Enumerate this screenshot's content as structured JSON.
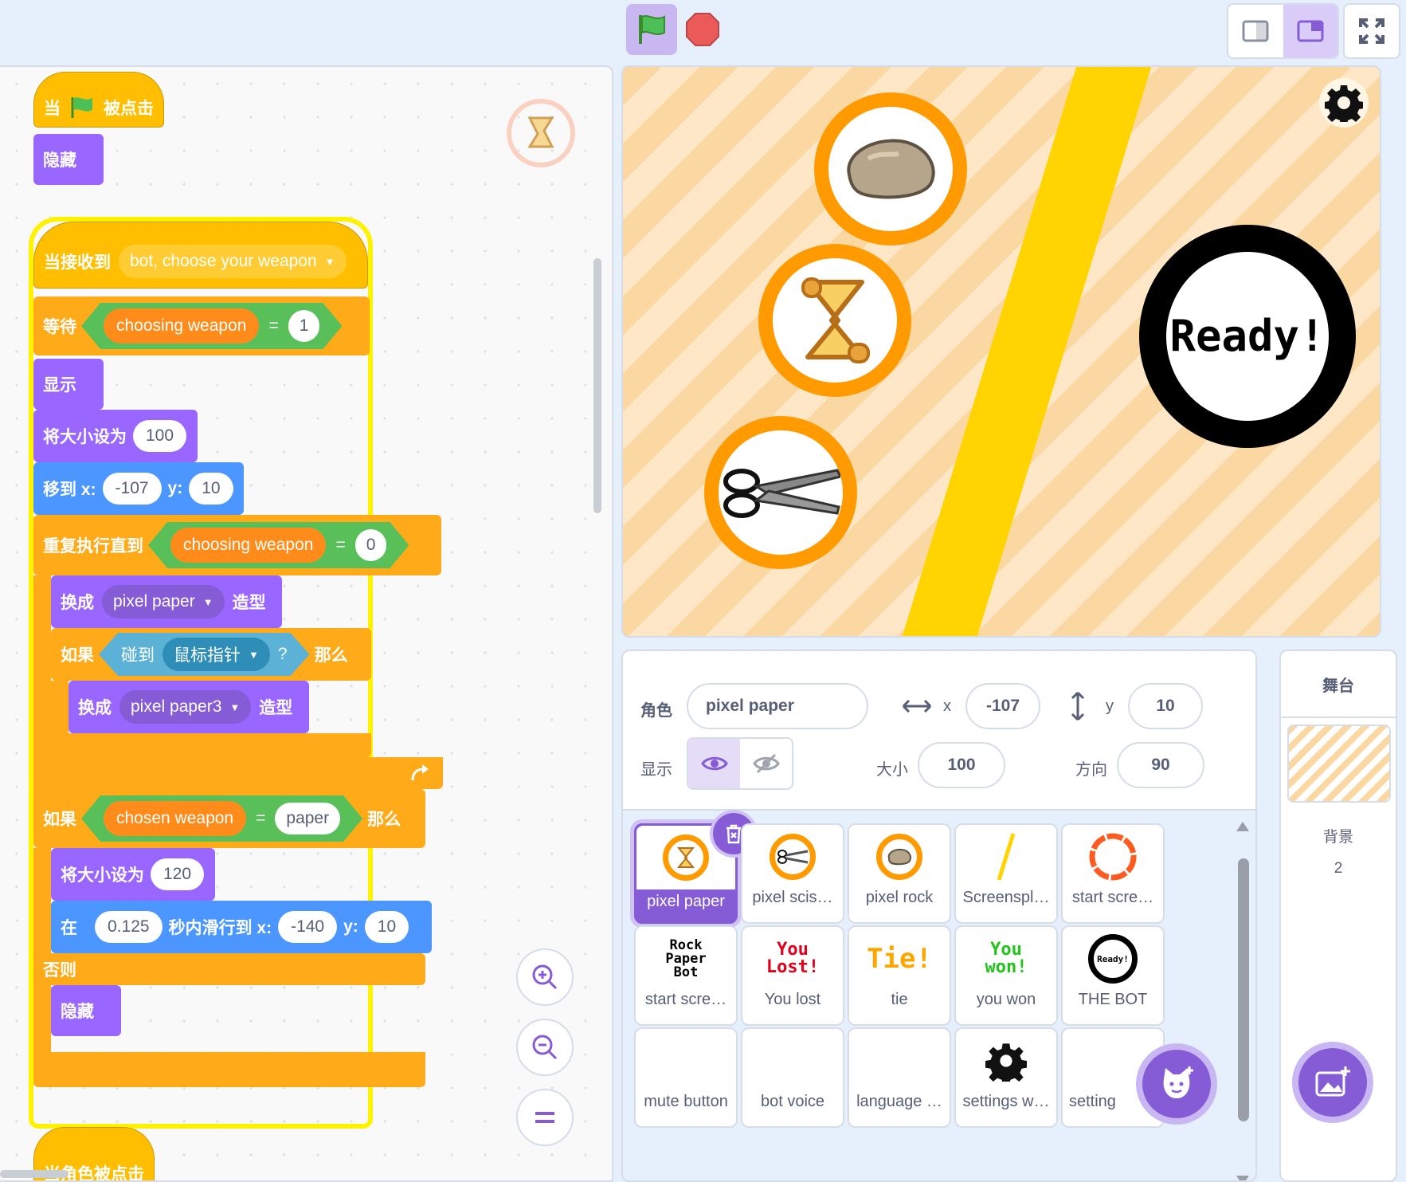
{
  "code": {
    "hat_flag": {
      "prefix": "当",
      "suffix": "被点击"
    },
    "hide1": "隐藏",
    "hat_receive": {
      "label": "当接收到",
      "message": "bot, choose your weapon"
    },
    "wait": {
      "label": "等待",
      "var": "choosing weapon",
      "op": "=",
      "value": "1"
    },
    "show": "显示",
    "setsize1": {
      "label": "将大小设为",
      "value": "100"
    },
    "goto": {
      "label": "移到 x:",
      "x": "-107",
      "ylabel": "y:",
      "y": "10"
    },
    "repeat_until": {
      "label": "重复执行直到",
      "var": "choosing weapon",
      "op": "=",
      "value": "0"
    },
    "switch1": {
      "label": "换成",
      "costume": "pixel paper",
      "suffix": "造型"
    },
    "if1": {
      "label": "如果",
      "touching": "碰到",
      "target": "鼠标指针",
      "q": "?",
      "then": "那么"
    },
    "switch2": {
      "label": "换成",
      "costume": "pixel paper3",
      "suffix": "造型"
    },
    "if2": {
      "label": "如果",
      "var": "chosen weapon",
      "op": "=",
      "value": "paper",
      "then": "那么"
    },
    "setsize2": {
      "label": "将大小设为",
      "value": "120"
    },
    "glide": {
      "label": "在",
      "secs": "0.125",
      "mid": "秒内滑行到 x:",
      "x": "-140",
      "ylabel": "y:",
      "y": "10"
    },
    "else": "否则",
    "hide2": "隐藏",
    "hat_clicked": "当角色被点击"
  },
  "stage": {
    "ready_text": "Ready!"
  },
  "sprite_info": {
    "sprite_label": "角色",
    "sprite_name": "pixel paper",
    "x_label": "x",
    "x": "-107",
    "y_label": "y",
    "y": "10",
    "show_label": "显示",
    "size_label": "大小",
    "size": "100",
    "direction_label": "方向",
    "direction": "90"
  },
  "sprites": [
    {
      "name": "pixel paper",
      "icon": "paper-scroll-icon",
      "selected": true
    },
    {
      "name": "pixel scis…",
      "icon": "scissors-icon"
    },
    {
      "name": "pixel rock",
      "icon": "rock-icon"
    },
    {
      "name": "Screenspl…",
      "icon": "yellow-line-icon"
    },
    {
      "name": "start scre…",
      "icon": "orange-ring-icon"
    },
    {
      "name": "start scre…",
      "icon": "rock-paper-bot-logo",
      "art": "Rock Paper Bot"
    },
    {
      "name": "You lost",
      "icon": "you-lost-text",
      "art": "You Lost!"
    },
    {
      "name": "tie",
      "icon": "tie-text",
      "art": "Tie!"
    },
    {
      "name": "you won",
      "icon": "you-won-text",
      "art": "You won!"
    },
    {
      "name": "THE BOT",
      "icon": "ready-ring-icon",
      "art": "Ready!"
    },
    {
      "name": "mute button",
      "icon": "blank"
    },
    {
      "name": "bot voice",
      "icon": "blank"
    },
    {
      "name": "language …",
      "icon": "blank"
    },
    {
      "name": "settings w…",
      "icon": "gear-icon"
    },
    {
      "name": "setting",
      "icon": "blank"
    }
  ],
  "stage_panel": {
    "title": "舞台",
    "backdrop_label": "背景",
    "backdrop_count": "2"
  },
  "colors": {
    "events": "#ffbf00",
    "control": "#ffab19",
    "looks": "#9966ff",
    "motion": "#4c97ff",
    "sensing": "#5cb1d6",
    "operators": "#59c059",
    "variables": "#ff8c1a",
    "accent": "#855cd6"
  }
}
